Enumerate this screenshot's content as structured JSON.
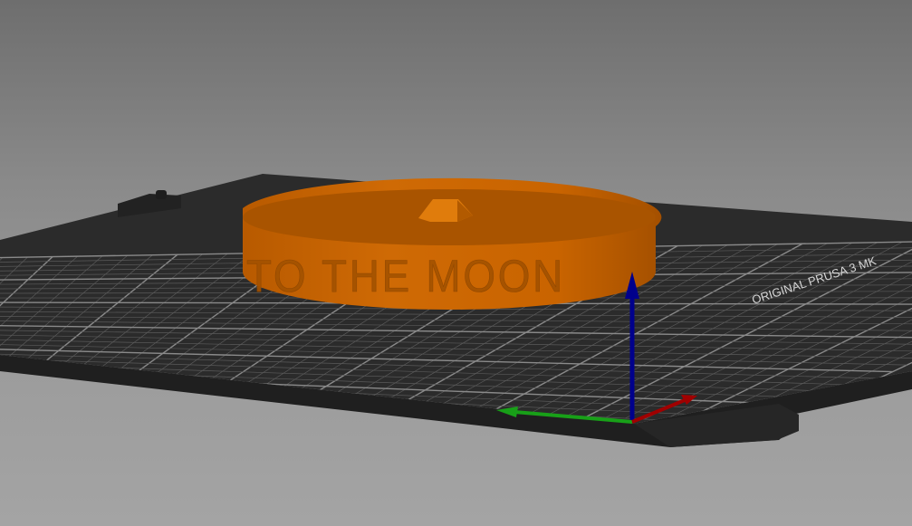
{
  "scene": {
    "model": {
      "engraved_text": "TO THE MOON",
      "color": "#c86400"
    },
    "bed": {
      "label": "ORIGINAL PRUSA 3 MK",
      "surface_color": "#2b2b2b",
      "grid_color": "#6a6a6a"
    },
    "axes": {
      "x_color": "#b00000",
      "y_color": "#18a018",
      "z_color": "#00008c"
    }
  }
}
